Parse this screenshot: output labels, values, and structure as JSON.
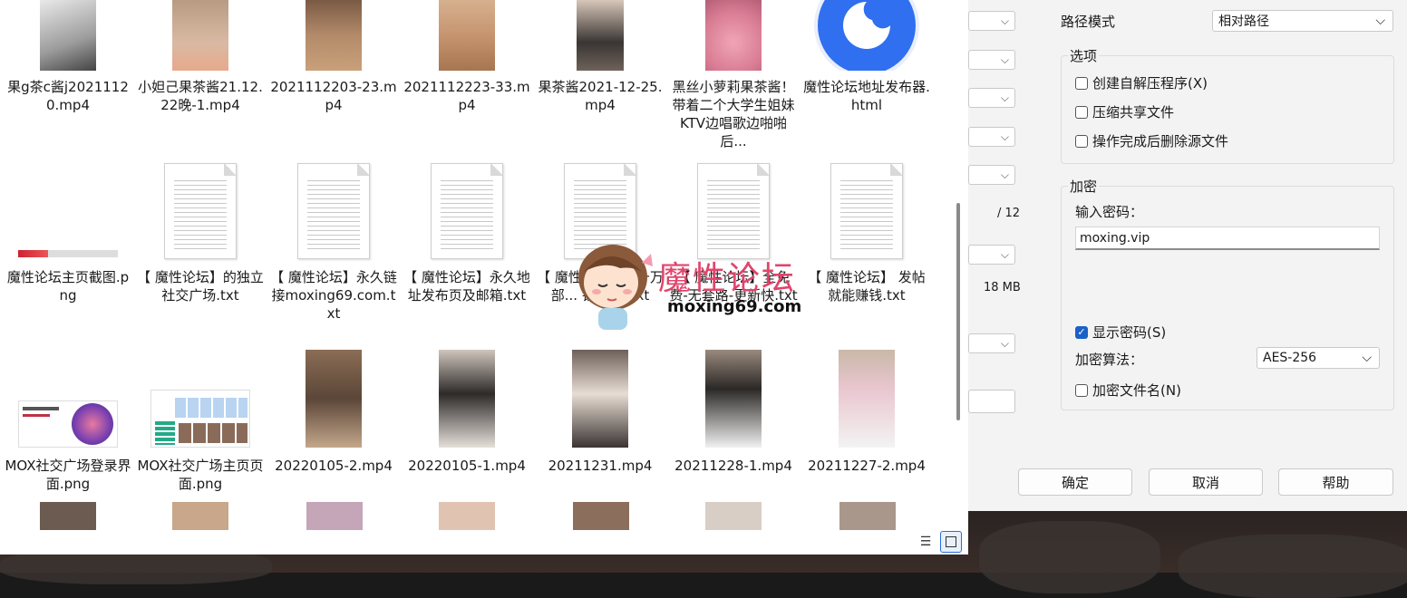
{
  "explorer": {
    "row1": [
      {
        "label": "果g茶c酱j20211120.mp4",
        "icon": "video-thumbnail"
      },
      {
        "label": "小妲己果茶酱21.12.22晚-1.mp4",
        "icon": "video-thumbnail"
      },
      {
        "label": "2021112203-23.mp4",
        "icon": "video-thumbnail"
      },
      {
        "label": "2021112223-33.mp4",
        "icon": "video-thumbnail"
      },
      {
        "label": "果茶酱2021-12-25.mp4",
        "icon": "video-thumbnail"
      },
      {
        "label": "黑丝小萝莉果茶酱！带着二个大学生姐妹KTV边唱歌边啪啪后...",
        "icon": "video-thumbnail"
      },
      {
        "label": "魔性论坛地址发布器.html",
        "icon": "browser-logo-icon"
      }
    ],
    "row2": [
      {
        "label": "魔性论坛主页截图.png",
        "icon": "image-thumbnail"
      },
      {
        "label": "【 魔性论坛】的独立社交广场.txt",
        "icon": "text-file-icon"
      },
      {
        "label": "【 魔性论坛】永久链接moxing69.com.txt",
        "icon": "text-file-icon"
      },
      {
        "label": "【 魔性论坛】永久地址发布页及邮箱.txt",
        "icon": "text-file-icon"
      },
      {
        "label": "【 魔性论坛】几十万部... 钱观... .txt",
        "icon": "text-file-icon"
      },
      {
        "label": "【 魔性论坛】全免费-无套路-更新快.txt",
        "icon": "text-file-icon"
      },
      {
        "label": "【 魔性论坛】 发帖就能赚钱.txt",
        "icon": "text-file-icon"
      }
    ],
    "row3": [
      {
        "label": "MOX社交广场登录界面.png",
        "icon": "image-thumbnail"
      },
      {
        "label": "MOX社交广场主页页面.png",
        "icon": "image-thumbnail"
      },
      {
        "label": "20220105-2.mp4",
        "icon": "video-thumbnail"
      },
      {
        "label": "20220105-1.mp4",
        "icon": "video-thumbnail"
      },
      {
        "label": "20211231.mp4",
        "icon": "video-thumbnail"
      },
      {
        "label": "20211228-1.mp4",
        "icon": "video-thumbnail"
      },
      {
        "label": "20211227-2.mp4",
        "icon": "video-thumbnail"
      }
    ]
  },
  "mid": {
    "page_of": "/ 12",
    "size": "18 MB"
  },
  "dialog": {
    "path_mode_label": "路径模式",
    "path_mode_value": "相对路径",
    "options_title": "选项",
    "opt_sfx": "创建自解压程序(X)",
    "opt_shared": "压缩共享文件",
    "opt_delete": "操作完成后删除源文件",
    "encrypt_title": "加密",
    "password_label": "输入密码：",
    "password_value": "moxing.vip",
    "show_password": "显示密码(S)",
    "algo_label": "加密算法：",
    "algo_value": "AES-256",
    "encrypt_names": "加密文件名(N)",
    "ok": "确定",
    "cancel": "取消",
    "help": "帮助"
  },
  "watermark": {
    "title": "魔性论坛",
    "url": "moxing69.com"
  },
  "colors": {
    "accent": "#1a62c7",
    "watermark": "#e0456c",
    "browser_logo": "#2f6ff0"
  }
}
